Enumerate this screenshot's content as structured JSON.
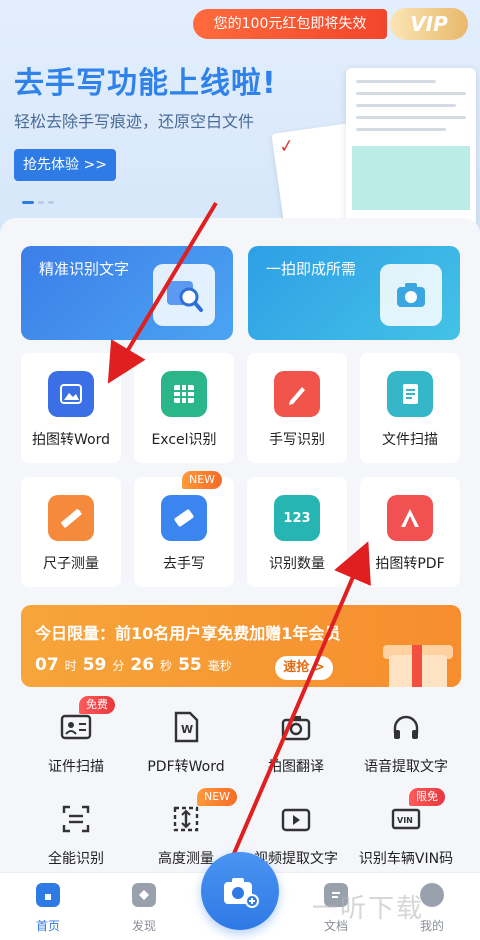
{
  "banner": {
    "promo_pill": "您的100元红包即将失效",
    "vip_badge": "VIP",
    "title": "去手写功能上线啦!",
    "subtitle": "轻松去除手写痕迹，还原空白文件",
    "try_button": "抢先体验 >>"
  },
  "hero_cards": [
    {
      "label": "精准识别文字",
      "icon": "image-search-icon"
    },
    {
      "label": "一拍即成所需",
      "icon": "camera-scan-icon"
    }
  ],
  "tools": [
    {
      "label": "拍图转Word",
      "icon": "image-to-word-icon",
      "color": "#3a6fe6"
    },
    {
      "label": "Excel识别",
      "icon": "excel-table-icon",
      "color": "#2bb68a"
    },
    {
      "label": "手写识别",
      "icon": "pen-icon",
      "color": "#f0544b"
    },
    {
      "label": "文件扫描",
      "icon": "document-scan-icon",
      "color": "#35b6c9"
    },
    {
      "label": "尺子测量",
      "icon": "ruler-icon",
      "color": "#f58a3c"
    },
    {
      "label": "去手写",
      "icon": "eraser-icon",
      "color": "#3a85f0",
      "tag": "NEW"
    },
    {
      "label": "识别数量",
      "icon": "count-123-icon",
      "color": "#27b5b3"
    },
    {
      "label": "拍图转PDF",
      "icon": "image-to-pdf-icon",
      "color": "#f25151"
    }
  ],
  "promo": {
    "title": "今日限量：前10名用户享免费加赠1年会员",
    "hours": "07",
    "hours_unit": "时",
    "minutes": "59",
    "minutes_unit": "分",
    "seconds": "26",
    "seconds_unit": "秒",
    "ms": "55",
    "ms_unit": "毫秒",
    "button": "速抢 >"
  },
  "mini_tools": [
    {
      "label": "证件扫描",
      "icon": "id-card-icon",
      "tag": "免费"
    },
    {
      "label": "PDF转Word",
      "icon": "pdf-to-word-icon"
    },
    {
      "label": "拍图翻译",
      "icon": "camera-translate-icon"
    },
    {
      "label": "语音提取文字",
      "icon": "headphones-icon"
    },
    {
      "label": "全能识别",
      "icon": "scan-frame-icon"
    },
    {
      "label": "高度测量",
      "icon": "height-measure-icon",
      "tag": "NEW"
    },
    {
      "label": "视频提取文字",
      "icon": "video-icon"
    },
    {
      "label": "识别车辆VIN码",
      "icon": "vin-code-icon",
      "tag": "限免"
    }
  ],
  "nav": {
    "home": "首页",
    "discover": "发现",
    "docs": "文档",
    "mine": "我的"
  },
  "watermark": "一听下载",
  "colors": {
    "accent": "#2f7be6",
    "promo_orange": "#f68d2e",
    "arrow_red": "#e02020"
  }
}
